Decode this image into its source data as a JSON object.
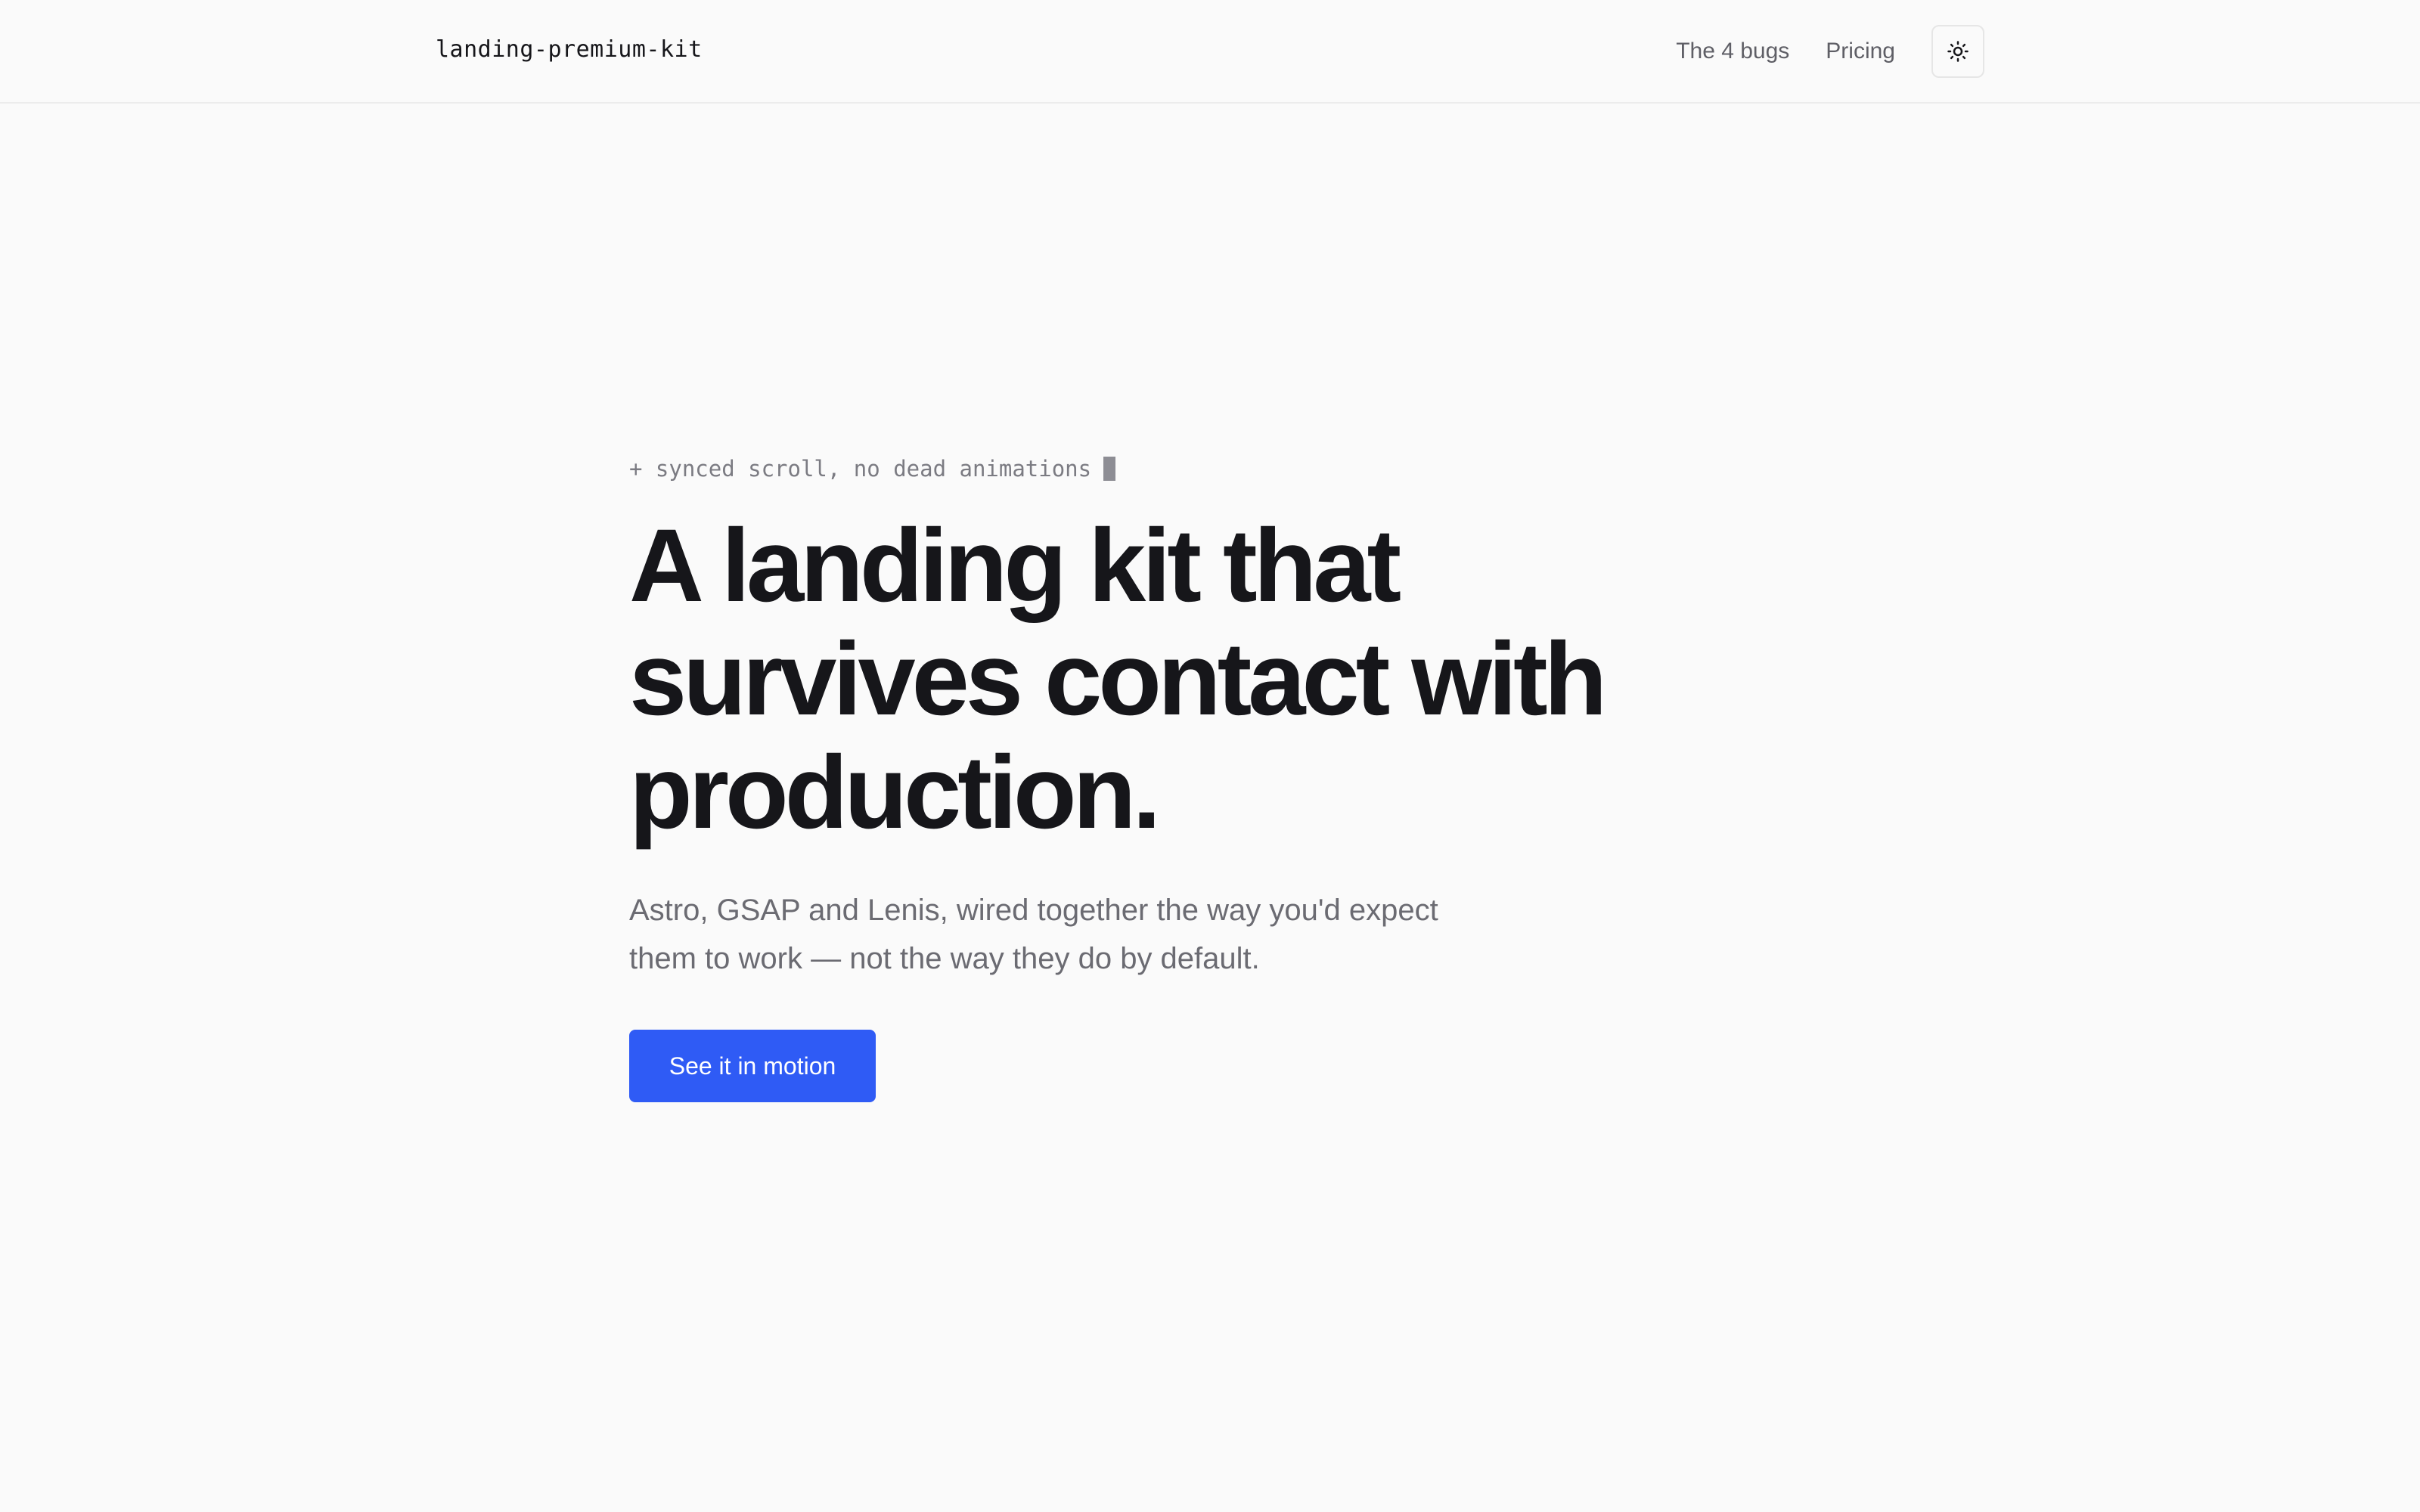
{
  "header": {
    "logo": "landing-premium-kit",
    "nav": [
      {
        "label": "The 4 bugs"
      },
      {
        "label": "Pricing"
      }
    ],
    "theme_toggle_icon": "sun-icon"
  },
  "hero": {
    "eyebrow": "+ synced scroll, no dead animations",
    "headline_lines": [
      "A landing kit that",
      "survives contact with",
      "production."
    ],
    "subtitle_lines": [
      "Astro, GSAP and Lenis, wired together the way you'd expect",
      "them to work — not the way they do by default."
    ],
    "cta_label": "See it in motion"
  },
  "colors": {
    "background": "#fafafa",
    "text": "#16161a",
    "muted": "#6b6b72",
    "accent": "#2f5bf5"
  }
}
